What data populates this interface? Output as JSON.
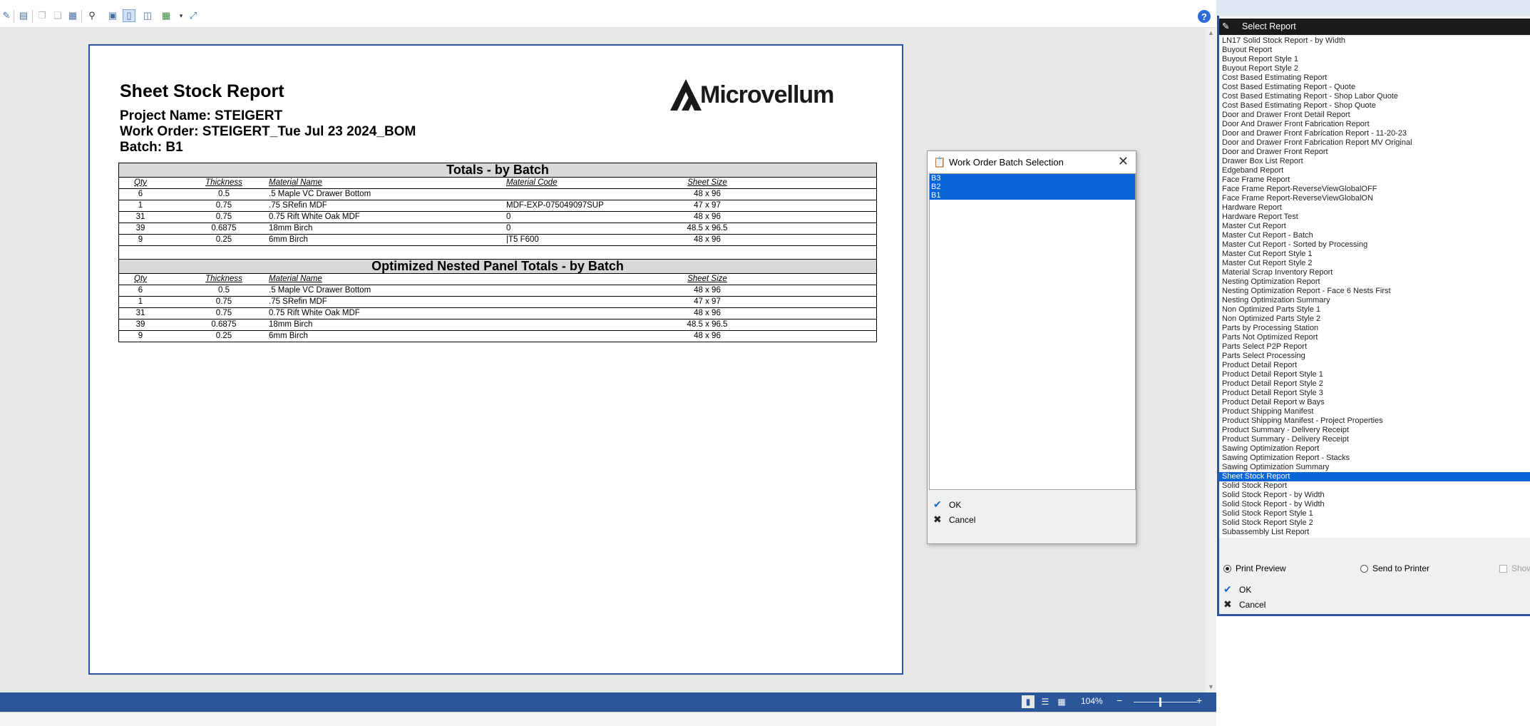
{
  "toolbar": {
    "buttons": [
      "edit-icon",
      "page-setup-icon",
      "copy-icon",
      "paste-icon",
      "table-icon",
      "binoculars-icon",
      "single-page-icon",
      "page-layout-icon",
      "two-page-icon",
      "multi-page-icon",
      "dropdown-arrow-icon",
      "fit-page-icon"
    ],
    "help_label": "?"
  },
  "report": {
    "title": "Sheet Stock Report",
    "project": "Project Name: STEIGERT",
    "work_order": "Work Order: STEIGERT_Tue Jul 23 2024_BOM",
    "batch": "Batch: B1",
    "logo_text": "Microvellum",
    "columns": {
      "qty": "Qty",
      "thickness": "Thickness",
      "material_name": "Material Name",
      "material_code": "Material Code",
      "sheet_size": "Sheet Size"
    },
    "totals": {
      "header": "Totals - by Batch",
      "rows": [
        {
          "qty": "6",
          "thickness": "0.5",
          "material": ".5 Maple VC Drawer Bottom",
          "code": "",
          "size": "48 x 96"
        },
        {
          "qty": "1",
          "thickness": "0.75",
          ".material": "",
          "material": ".75 SRefin MDF",
          "code": "MDF-EXP-075049097SUP",
          "size": "47 x 97"
        },
        {
          "qty": "31",
          "thickness": "0.75",
          "material": "0.75 Rift White Oak MDF",
          "code": "0",
          "size": "48 x 96"
        },
        {
          "qty": "39",
          "thickness": "0.6875",
          "material": "18mm Birch",
          "code": "0",
          "size": "48.5 x 96.5"
        },
        {
          "qty": "9",
          "thickness": "0.25",
          "material": "6mm Birch",
          "code": "|T5 F600",
          "size": "48 x 96"
        }
      ]
    },
    "nested": {
      "header": "Optimized Nested Panel Totals -  by Batch",
      "rows": [
        {
          "qty": "6",
          "thickness": "0.5",
          "material": ".5 Maple VC Drawer Bottom",
          "size": "48 x 96"
        },
        {
          "qty": "1",
          "thickness": "0.75",
          "material": ".75 SRefin MDF",
          "size": "47 x 97"
        },
        {
          "qty": "31",
          "thickness": "0.75",
          "material": "0.75 Rift White Oak MDF",
          "size": "48 x 96"
        },
        {
          "qty": "39",
          "thickness": "0.6875",
          "material": "18mm Birch",
          "size": "48.5 x 96.5"
        },
        {
          "qty": "9",
          "thickness": "0.25",
          "material": "6mm Birch",
          "size": "48 x 96"
        }
      ]
    }
  },
  "status_bar": {
    "zoom": "104%",
    "zoom_out": "−",
    "zoom_in": "+"
  },
  "batch_dialog": {
    "title": "Work Order Batch Selection",
    "items": [
      "B3",
      "B2",
      "B1"
    ],
    "ok_label": "OK",
    "cancel_label": "Cancel"
  },
  "select_report": {
    "title": "Select Report",
    "selected": "Sheet Stock Report",
    "items": [
      "LN17 Solid Stock Report - by Width",
      "Buyout Report",
      "Buyout Report Style 1",
      "Buyout Report Style 2",
      "Cost Based Estimating Report",
      "Cost Based Estimating Report - Quote",
      "Cost Based Estimating Report - Shop Labor Quote",
      "Cost Based Estimating Report - Shop Quote",
      "Door and Drawer Front Detail Report",
      "Door And Drawer Front Fabrication Report",
      "Door and Drawer Front Fabrication Report - 11-20-23",
      "Door and Drawer Front Fabrication Report MV Original",
      "Door and Drawer Front Report",
      "Drawer Box List Report",
      "Edgeband Report",
      "Face Frame Report",
      "Face Frame Report-ReverseViewGlobalOFF",
      "Face Frame Report-ReverseViewGlobalON",
      "Hardware Report",
      "Hardware Report Test",
      "Master Cut Report",
      "Master Cut Report - Batch",
      "Master Cut Report - Sorted by Processing",
      "Master Cut Report Style 1",
      "Master Cut Report Style 2",
      "Material Scrap Inventory Report",
      "Nesting Optimization Report",
      "Nesting Optimization Report - Face 6 Nests First",
      "Nesting Optimization Summary",
      "Non Optimized Parts Style 1",
      "Non Optimized Parts Style 2",
      "Parts by Processing Station",
      "Parts Not Optimized Report",
      "Parts Select P2P Report",
      "Parts Select Processing",
      "Product Detail Report",
      "Product Detail Report Style 1",
      "Product Detail Report Style 2",
      "Product Detail Report Style 3",
      "Product Detail Report w Bays",
      "Product Shipping Manifest",
      "Product Shipping Manifest - Project Properties",
      "Product Summary - Delivery Receipt",
      "Product Summary - Delivery Receipt",
      "Sawing Optimization Report",
      "Sawing Optimization Report - Stacks",
      "Sawing Optimization Summary",
      "Sheet Stock Report",
      "Solid Stock Report",
      "Solid Stock Report - by Width",
      "Solid Stock Report - by Width",
      "Solid Stock Report Style 1",
      "Solid Stock Report Style 2",
      "Subassembly List Report"
    ],
    "print_preview_label": "Print Preview",
    "send_to_printer_label": "Send to Printer",
    "show_label": "Show",
    "ok_label": "OK",
    "cancel_label": "Cancel"
  }
}
